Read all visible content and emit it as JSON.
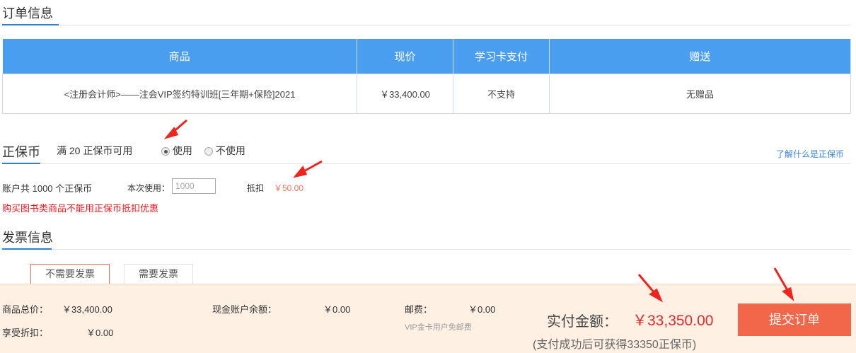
{
  "order": {
    "title": "订单信息",
    "headers": [
      "商品",
      "现价",
      "学习卡支付",
      "赠送"
    ],
    "row": {
      "product": "<注册会计师>——注会VIP签约特训班[三年期+保险]2021",
      "price": "￥33,400.00",
      "card": "不支持",
      "gift": "无赠品"
    }
  },
  "coin": {
    "title": "正保币",
    "condition": "满 20 正保币可用",
    "use": "使用",
    "not_use": "不使用",
    "learn_link": "了解什么是正保币",
    "account": "账户共 1000 个正保币",
    "use_label": "本次使用：",
    "use_value": "1000",
    "deduct_label": "抵扣",
    "deduct_value": "￥50.00",
    "warning": "购买图书类商品不能用正保币抵扣优惠"
  },
  "invoice": {
    "title": "发票信息",
    "no_invoice": "不需要发票",
    "need_invoice": "需要发票"
  },
  "footer": {
    "total_label": "商品总价：",
    "total": "￥33,400.00",
    "discount_label": "享受折扣：",
    "discount": "￥0.00",
    "balance_label": "现金账户余额：",
    "balance": "￥0.00",
    "postage_label": "邮费：",
    "postage": "￥0.00",
    "postage_note": "VIP金卡用户免邮费",
    "pay_label": "实付金额：",
    "pay": "￥33,350.00",
    "reward": "(支付成功后可获得33350正保币)",
    "submit": "提交订单"
  },
  "colors": {
    "accent": "#4a9ef0",
    "submit": "#f2674a",
    "price_red": "#e8262b"
  }
}
